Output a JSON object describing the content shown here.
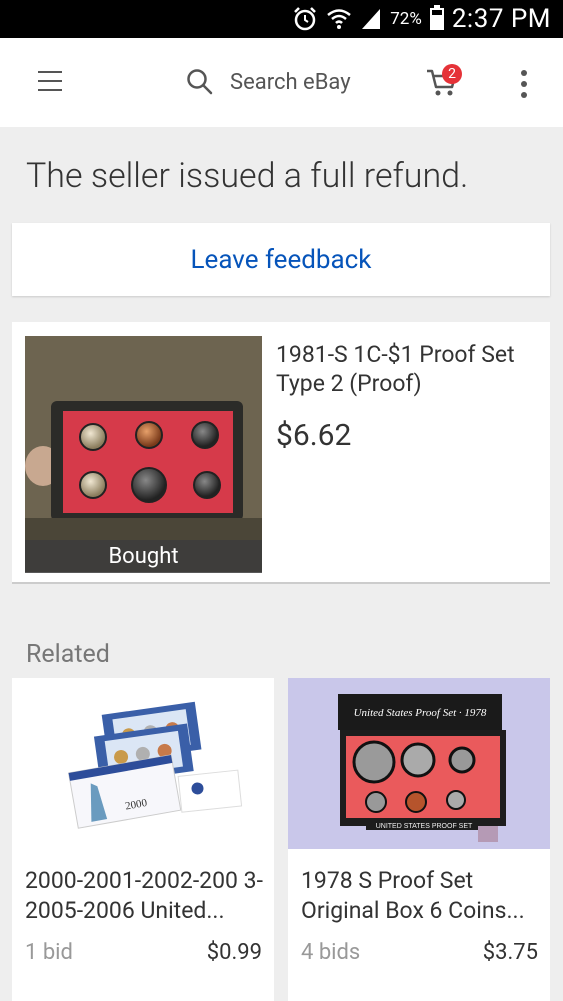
{
  "status_bar": {
    "battery": "72%",
    "time": "2:37 PM"
  },
  "app_bar": {
    "search_placeholder": "Search eBay",
    "cart_count": "2"
  },
  "message": {
    "headline": "The seller issued a full refund."
  },
  "feedback": {
    "label": "Leave feedback"
  },
  "item": {
    "title": "1981-S 1C-$1 Proof Set Type 2 (Proof)",
    "price": "$6.62",
    "badge": "Bought"
  },
  "related": {
    "heading": "Related",
    "items": [
      {
        "title": "2000-2001-2002-200 3-2005-2006 United...",
        "bids": "1 bid",
        "price": "$0.99",
        "image_text": "2000"
      },
      {
        "title": "1978 S Proof Set Original Box 6 Coins...",
        "bids": "4 bids",
        "price": "$3.75",
        "image_text": "United States Proof Set · 1978"
      }
    ]
  },
  "colors": {
    "link": "#0654ba",
    "badge": "#e53238"
  }
}
